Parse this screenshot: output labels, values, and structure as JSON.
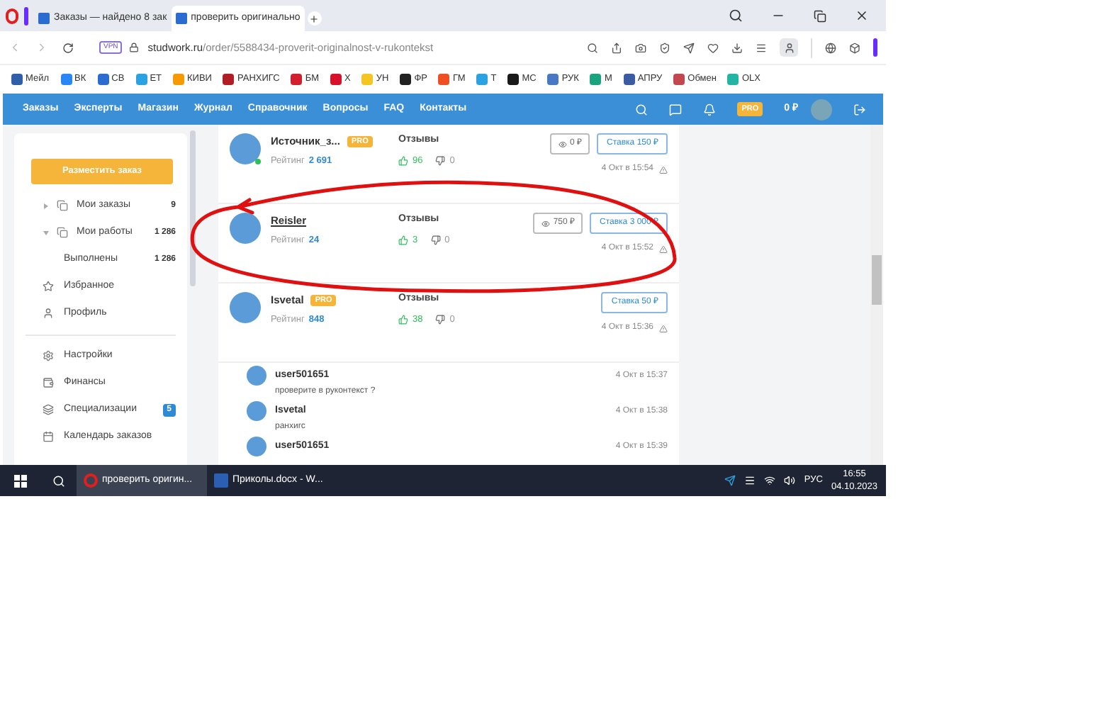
{
  "browser": {
    "tabs": [
      {
        "title": "Заказы — найдено 8 зак",
        "selected": false
      },
      {
        "title": "проверить оригинальнo",
        "selected": true
      }
    ],
    "address": {
      "vpn": "VPN",
      "domain": "studwork.ru",
      "path": "/order/5588434-proverit-originalnost-v-rukontekst"
    },
    "bookmarks": [
      {
        "label": "Мейл",
        "color": "#2f5fa8"
      },
      {
        "label": "ВК",
        "color": "#2787f5"
      },
      {
        "label": "СВ",
        "color": "#2b6cd1"
      },
      {
        "label": "ЕТ",
        "color": "#2aa1e0"
      },
      {
        "label": "КИВИ",
        "color": "#f59a00"
      },
      {
        "label": "РАНХИГС",
        "color": "#b01d24"
      },
      {
        "label": "БМ",
        "color": "#d01f2f"
      },
      {
        "label": "Х",
        "color": "#d8112a"
      },
      {
        "label": "УН",
        "color": "#f3c623"
      },
      {
        "label": "ФР",
        "color": "#222222"
      },
      {
        "label": "ГМ",
        "color": "#f04e23"
      },
      {
        "label": "Т",
        "color": "#2aa1e0"
      },
      {
        "label": "МС",
        "color": "#1a1a1a"
      },
      {
        "label": "РУК",
        "color": "#4a78c2"
      },
      {
        "label": "М",
        "color": "#1aa37e"
      },
      {
        "label": "АПРУ",
        "color": "#3b5ba5"
      },
      {
        "label": "Обмен",
        "color": "#c2474f"
      },
      {
        "label": "OLX",
        "color": "#23b5a3"
      }
    ]
  },
  "site_nav": {
    "items": [
      "Заказы",
      "Эксперты",
      "Магазин",
      "Журнал",
      "Справочник",
      "Вопросы",
      "FAQ",
      "Контакты"
    ],
    "pro": "PRO",
    "balance": "0 ₽"
  },
  "sidebar": {
    "button": "Разместить заказ",
    "items": [
      {
        "kind": "tree",
        "label": "Мои заказы",
        "count": "9",
        "expanded": false
      },
      {
        "kind": "tree",
        "label": "Мои работы",
        "count": "1 286",
        "expanded": true
      },
      {
        "kind": "sub",
        "label": "Выполнены",
        "count": "1 286"
      },
      {
        "kind": "star",
        "label": "Избранное"
      },
      {
        "kind": "user",
        "label": "Профиль"
      },
      {
        "kind": "divider"
      },
      {
        "kind": "gear",
        "label": "Настройки"
      },
      {
        "kind": "wallet",
        "label": "Финансы"
      },
      {
        "kind": "spec",
        "label": "Специализации",
        "badge": "5"
      },
      {
        "kind": "calendar",
        "label": "Календарь заказов"
      }
    ]
  },
  "bids": [
    {
      "name": "Источник_з...",
      "pro": "PRO",
      "underlined": false,
      "online": true,
      "rating_label": "Рейтинг",
      "rating": "2 691",
      "reviews": "Отзывы",
      "likes": "96",
      "dislikes": "0",
      "views": "0 ₽",
      "bid": "Ставка 150 ₽",
      "time": "4 Окт в 15:54"
    },
    {
      "name": "Reisler",
      "underlined": true,
      "online": false,
      "rating_label": "Рейтинг",
      "rating": "24",
      "reviews": "Отзывы",
      "likes": "3",
      "dislikes": "0",
      "views": "750 ₽",
      "bid": "Ставка 3 000 ₽",
      "time": "4 Окт в 15:52"
    },
    {
      "name": "Isvetal",
      "pro": "PRO",
      "underlined": false,
      "online": false,
      "rating_label": "Рейтинг",
      "rating": "848",
      "reviews": "Отзывы",
      "likes": "38",
      "dislikes": "0",
      "bid": "Ставка 50 ₽",
      "time": "4 Окт в 15:36"
    }
  ],
  "comments": [
    {
      "user": "user501651",
      "time": "4 Окт в 15:37",
      "text": "проверите в руконтекст ?"
    },
    {
      "user": "Isvetal",
      "time": "4 Окт в 15:38",
      "text": "ранхигс"
    },
    {
      "user": "user501651",
      "time": "4 Окт в 15:39"
    }
  ],
  "taskbar": {
    "apps": [
      {
        "title": "проверить оригин...",
        "selected": true,
        "kind": "browser"
      },
      {
        "title": "Приколы.docx - W...",
        "selected": false,
        "kind": "word"
      }
    ],
    "language": "РУС",
    "time": "16:55",
    "date": "04.10.2023"
  }
}
